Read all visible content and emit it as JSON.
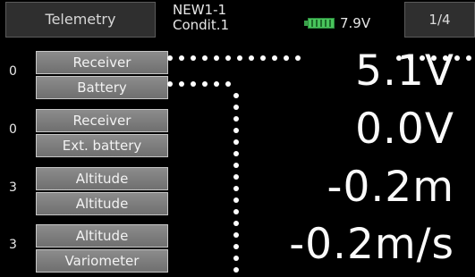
{
  "header": {
    "title": "Telemetry",
    "model_line1": "NEW1-1",
    "model_line2": "Condit.1",
    "battery_voltage": "7.9V",
    "page": "1/4"
  },
  "rows": [
    {
      "slot": "0",
      "sensor": "Receiver",
      "item": "Battery",
      "value": "5.1V"
    },
    {
      "slot": "0",
      "sensor": "Receiver",
      "item": "Ext. battery",
      "value": "0.0V"
    },
    {
      "slot": "3",
      "sensor": "Altitude",
      "item": "Altitude",
      "value": "-0.2m"
    },
    {
      "slot": "3",
      "sensor": "Altitude",
      "item": "Variometer",
      "value": "-0.2m/s"
    }
  ],
  "icons": {
    "battery": "battery-icon"
  },
  "colors": {
    "background": "#000000",
    "button": "#7a7a7a",
    "battery": "#49c45c"
  }
}
